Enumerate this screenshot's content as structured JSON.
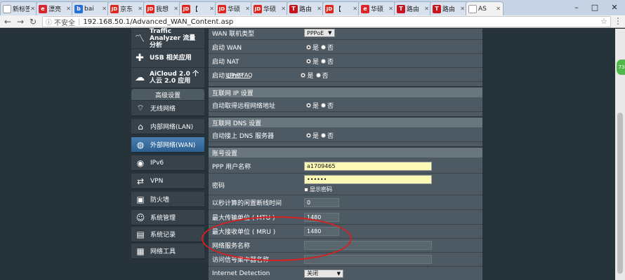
{
  "browser": {
    "tabs": [
      {
        "label": "新标签",
        "fav": "w",
        "favtext": ""
      },
      {
        "label": "漂亮",
        "fav": "red",
        "favtext": "e"
      },
      {
        "label": "bai",
        "fav": "blue",
        "favtext": "b"
      },
      {
        "label": "京东",
        "fav": "jd",
        "favtext": "JD"
      },
      {
        "label": "我想",
        "fav": "jd",
        "favtext": "JD"
      },
      {
        "label": "【",
        "fav": "jd",
        "favtext": "JD"
      },
      {
        "label": "华硕",
        "fav": "jd",
        "favtext": "JD"
      },
      {
        "label": "华硕",
        "fav": "jd",
        "favtext": "JD"
      },
      {
        "label": "路由",
        "fav": "t",
        "favtext": "T"
      },
      {
        "label": "【",
        "fav": "jd",
        "favtext": "JD"
      },
      {
        "label": "华硕",
        "fav": "red",
        "favtext": "e"
      },
      {
        "label": "路由",
        "fav": "t",
        "favtext": "T"
      },
      {
        "label": "路由",
        "fav": "t",
        "favtext": "T"
      },
      {
        "label": "AS",
        "fav": "w",
        "favtext": ""
      }
    ],
    "security_label": "不安全",
    "url": "192.168.50.1/Advanced_WAN_Content.asp"
  },
  "sidebar": {
    "top_items": [
      {
        "label": "Traffic Analyzer 流量分析",
        "icon": "traffic-analyzer-icon"
      },
      {
        "label": "USB 相关应用",
        "icon": "usb-puzzle-icon"
      },
      {
        "label": "AiCloud 2.0 个人云 2.0 应用",
        "icon": "aicloud-icon"
      }
    ],
    "section_title": "高级设置",
    "items": [
      {
        "label": "无线网络",
        "icon": "wifi-icon"
      },
      {
        "label": "内部网络(LAN)",
        "icon": "home-icon"
      },
      {
        "label": "外部网络(WAN)",
        "icon": "globe-icon"
      },
      {
        "label": "IPv6",
        "icon": "ipv6-icon"
      },
      {
        "label": "VPN",
        "icon": "vpn-icon"
      },
      {
        "label": "防火墙",
        "icon": "firewall-icon"
      },
      {
        "label": "系统管理",
        "icon": "admin-icon"
      },
      {
        "label": "系统记录",
        "icon": "log-icon"
      },
      {
        "label": "网络工具",
        "icon": "tools-icon"
      }
    ]
  },
  "form": {
    "wan_type_label": "WAN 联机类型",
    "wan_type_value": "PPPoE",
    "enable_wan_label": "启动 WAN",
    "enable_nat_label": "启动 NAT",
    "enable_upnp_label": "启动 UPnP",
    "upnp_faq": "UPnP FAQ",
    "yes": "是",
    "no": "否",
    "ip_section": "互联网 IP 设置",
    "auto_ip_label": "自动取得远程网络地址",
    "dns_section": "互联网 DNS 设置",
    "auto_dns_label": "自动接上 DNS 服务器",
    "account_section": "账号设置",
    "ppp_user_label": "PPP 用户名称",
    "ppp_user_value": "a1709465",
    "password_label": "密码",
    "password_value": "••••••",
    "show_password_label": "显示密码",
    "idle_label": "以秒计算的闲置断线时间",
    "idle_value": "0",
    "mtu_label": "最大传输单位 ( MTU )",
    "mtu_value": "1480",
    "mru_label": "最大接收单位 ( MRU )",
    "mru_value": "1480",
    "service_name_label": "网络服务名称",
    "access_concentrator_label": "访问信号集中器名称",
    "internet_detection_label": "Internet Detection",
    "internet_detection_value": "关闭"
  },
  "badge": "73"
}
